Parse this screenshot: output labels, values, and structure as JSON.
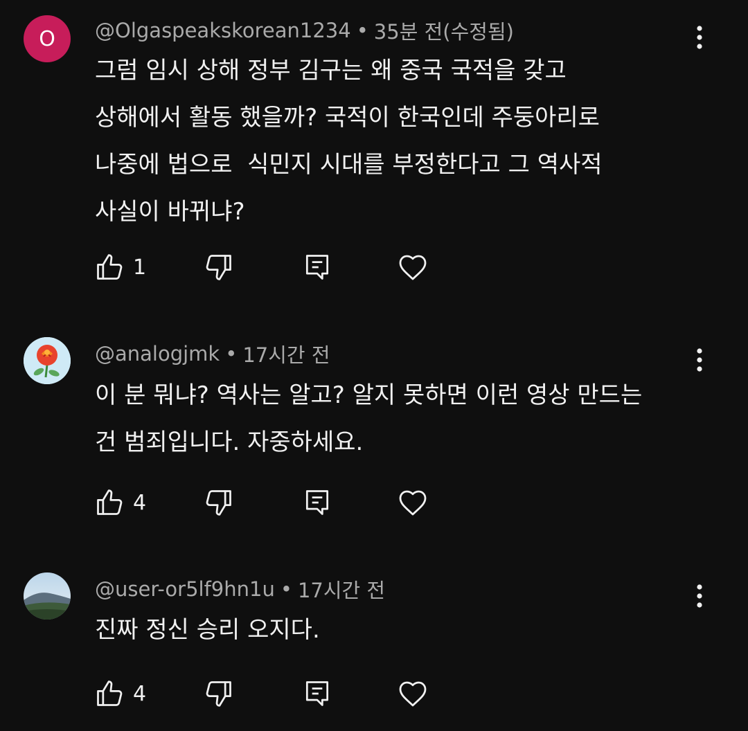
{
  "colors": {
    "background": "#0f0f0f",
    "text_primary": "#f1f1f1",
    "text_secondary": "#aaaaaa",
    "avatar_letter_bg": "#c71d5a"
  },
  "icons": {
    "like": "thumbs-up-icon",
    "dislike": "thumbs-down-icon",
    "reply": "reply-comment-icon",
    "heart": "heart-icon",
    "more": "more-vertical-icon"
  },
  "comments": [
    {
      "avatar_letter": "O",
      "author": "@Olgaspeakskorean1234",
      "separator": "•",
      "time": "35분 전(수정됨)",
      "lines": [
        "그럼 임시 상해 정부 김구는 왜 중국 국적을 갖고",
        "상해에서 활동 했을까? 국적이 한국인데 주둥아리로",
        "나중에 법으로  식민지 시대를 부정한다고 그 역사적",
        "사실이 바뀌냐?"
      ],
      "likes": "1"
    },
    {
      "avatar_letter": "",
      "author": "@analogjmk",
      "separator": "•",
      "time": "17시간 전",
      "lines": [
        "이 분 뭐냐? 역사는 알고? 알지 못하면 이런 영상 만드는",
        "건 범죄입니다. 자중하세요."
      ],
      "likes": "4"
    },
    {
      "avatar_letter": "",
      "author": "@user-or5lf9hn1u",
      "separator": "•",
      "time": "17시간 전",
      "lines": [
        "진짜 정신 승리 오지다."
      ],
      "likes": "4"
    }
  ]
}
